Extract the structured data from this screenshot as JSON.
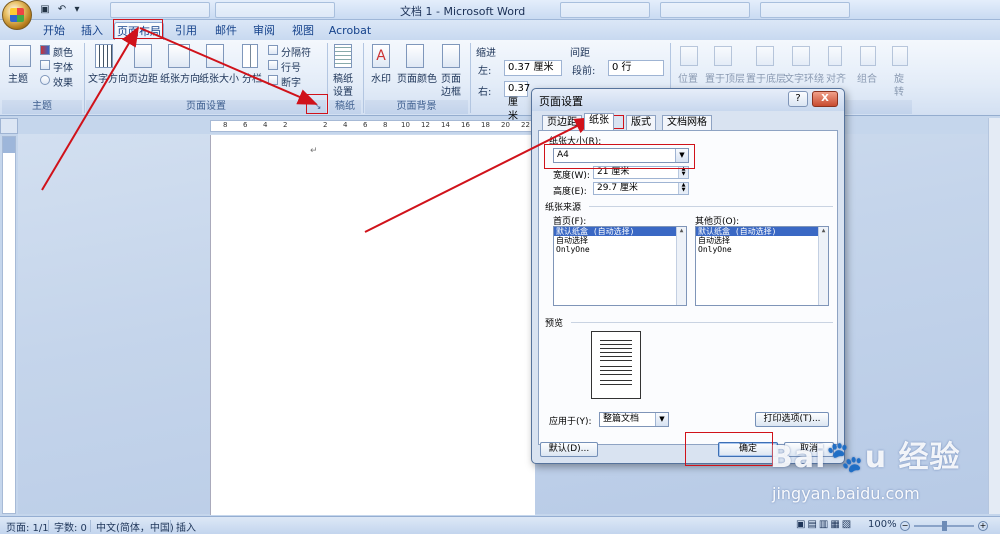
{
  "window": {
    "title": "文档 1 - Microsoft Word"
  },
  "quick_access": {
    "save_icon": "save-icon",
    "undo_icon": "undo-icon",
    "dropdown_icon": "chevron-down-icon"
  },
  "tabs": [
    {
      "label": "开始"
    },
    {
      "label": "插入"
    },
    {
      "label": "页面布局"
    },
    {
      "label": "引用"
    },
    {
      "label": "邮件"
    },
    {
      "label": "审阅"
    },
    {
      "label": "视图"
    },
    {
      "label": "Acrobat"
    }
  ],
  "ribbon": {
    "themes": {
      "theme_button": "主题",
      "colors": "颜色",
      "fonts": "字体",
      "effects": "效果",
      "group": "主题"
    },
    "page_setup": {
      "text_direction": "文字方向",
      "margins": "页边距",
      "orientation": "纸张方向",
      "size": "纸张大小",
      "columns": "分栏",
      "breaks": "分隔符",
      "line_numbers": "行号",
      "hyphenation": "断字",
      "group": "页面设置"
    },
    "manuscript": {
      "button_line1": "稿纸",
      "button_line2": "设置",
      "group": "稿纸"
    },
    "background": {
      "watermark": "水印",
      "page_color": "页面颜色",
      "page_border_line1": "页面",
      "page_border_line2": "边框",
      "group": "页面背景"
    },
    "paragraph": {
      "indent_title": "缩进",
      "spacing_title": "间距",
      "left_label": "左:",
      "left_value": "0.37 厘米",
      "right_label": "右:",
      "right_value": "0.37 厘米",
      "before_label": "段前:",
      "before_value": "0 行"
    },
    "arrange": {
      "position": "位置",
      "bring_front": "置于顶层",
      "send_back": "置于底层",
      "text_wrap": "文字环绕",
      "align": "对齐",
      "group_btn": "组合",
      "rotate_line1": "旋",
      "rotate_line2": "转"
    }
  },
  "ruler": {
    "ticks": [
      "8",
      "6",
      "4",
      "2",
      "",
      "2",
      "4",
      "6",
      "8",
      "10",
      "12",
      "14",
      "16",
      "18",
      "20",
      "22"
    ]
  },
  "dialog": {
    "title": "页面设置",
    "help": "?",
    "close": "X",
    "tabs": [
      "页边距",
      "纸张",
      "版式",
      "文档网格"
    ],
    "paper_size_label": "纸张大小(R):",
    "paper_size_value": "A4",
    "width_label": "宽度(W):",
    "width_value": "21 厘米",
    "height_label": "高度(E):",
    "height_value": "29.7 厘米",
    "source_title": "纸张来源",
    "first_page_label": "首页(F):",
    "other_pages_label": "其他页(O):",
    "first_page_options": [
      "默认纸盒 (自动选择)",
      "自动选择",
      "OnlyOne"
    ],
    "other_pages_options": [
      "默认纸盒 (自动选择)",
      "自动选择",
      "OnlyOne"
    ],
    "preview_label": "预览",
    "apply_to_label": "应用于(Y):",
    "apply_to_value": "整篇文档",
    "print_options": "打印选项(T)...",
    "default_button": "默认(D)...",
    "ok_button": "确定",
    "cancel_button": "取消"
  },
  "statusbar": {
    "page": "页面: 1/1",
    "words": "字数: 0",
    "language": "中文(简体，中国)",
    "mode": "插入",
    "zoom": "100%"
  },
  "watermark": {
    "url": "jingyan.baidu.com"
  },
  "colors": {
    "annotation_red": "#d0121a",
    "ribbon_blue": "#15428b"
  }
}
